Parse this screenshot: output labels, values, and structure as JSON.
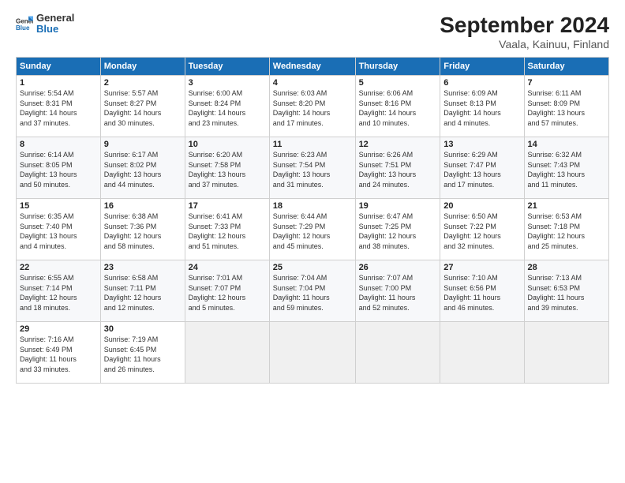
{
  "header": {
    "logo_general": "General",
    "logo_blue": "Blue",
    "title": "September 2024",
    "subtitle": "Vaala, Kainuu, Finland"
  },
  "days_of_week": [
    "Sunday",
    "Monday",
    "Tuesday",
    "Wednesday",
    "Thursday",
    "Friday",
    "Saturday"
  ],
  "weeks": [
    [
      {
        "day": "1",
        "info": "Sunrise: 5:54 AM\nSunset: 8:31 PM\nDaylight: 14 hours\nand 37 minutes."
      },
      {
        "day": "2",
        "info": "Sunrise: 5:57 AM\nSunset: 8:27 PM\nDaylight: 14 hours\nand 30 minutes."
      },
      {
        "day": "3",
        "info": "Sunrise: 6:00 AM\nSunset: 8:24 PM\nDaylight: 14 hours\nand 23 minutes."
      },
      {
        "day": "4",
        "info": "Sunrise: 6:03 AM\nSunset: 8:20 PM\nDaylight: 14 hours\nand 17 minutes."
      },
      {
        "day": "5",
        "info": "Sunrise: 6:06 AM\nSunset: 8:16 PM\nDaylight: 14 hours\nand 10 minutes."
      },
      {
        "day": "6",
        "info": "Sunrise: 6:09 AM\nSunset: 8:13 PM\nDaylight: 14 hours\nand 4 minutes."
      },
      {
        "day": "7",
        "info": "Sunrise: 6:11 AM\nSunset: 8:09 PM\nDaylight: 13 hours\nand 57 minutes."
      }
    ],
    [
      {
        "day": "8",
        "info": "Sunrise: 6:14 AM\nSunset: 8:05 PM\nDaylight: 13 hours\nand 50 minutes."
      },
      {
        "day": "9",
        "info": "Sunrise: 6:17 AM\nSunset: 8:02 PM\nDaylight: 13 hours\nand 44 minutes."
      },
      {
        "day": "10",
        "info": "Sunrise: 6:20 AM\nSunset: 7:58 PM\nDaylight: 13 hours\nand 37 minutes."
      },
      {
        "day": "11",
        "info": "Sunrise: 6:23 AM\nSunset: 7:54 PM\nDaylight: 13 hours\nand 31 minutes."
      },
      {
        "day": "12",
        "info": "Sunrise: 6:26 AM\nSunset: 7:51 PM\nDaylight: 13 hours\nand 24 minutes."
      },
      {
        "day": "13",
        "info": "Sunrise: 6:29 AM\nSunset: 7:47 PM\nDaylight: 13 hours\nand 17 minutes."
      },
      {
        "day": "14",
        "info": "Sunrise: 6:32 AM\nSunset: 7:43 PM\nDaylight: 13 hours\nand 11 minutes."
      }
    ],
    [
      {
        "day": "15",
        "info": "Sunrise: 6:35 AM\nSunset: 7:40 PM\nDaylight: 13 hours\nand 4 minutes."
      },
      {
        "day": "16",
        "info": "Sunrise: 6:38 AM\nSunset: 7:36 PM\nDaylight: 12 hours\nand 58 minutes."
      },
      {
        "day": "17",
        "info": "Sunrise: 6:41 AM\nSunset: 7:33 PM\nDaylight: 12 hours\nand 51 minutes."
      },
      {
        "day": "18",
        "info": "Sunrise: 6:44 AM\nSunset: 7:29 PM\nDaylight: 12 hours\nand 45 minutes."
      },
      {
        "day": "19",
        "info": "Sunrise: 6:47 AM\nSunset: 7:25 PM\nDaylight: 12 hours\nand 38 minutes."
      },
      {
        "day": "20",
        "info": "Sunrise: 6:50 AM\nSunset: 7:22 PM\nDaylight: 12 hours\nand 32 minutes."
      },
      {
        "day": "21",
        "info": "Sunrise: 6:53 AM\nSunset: 7:18 PM\nDaylight: 12 hours\nand 25 minutes."
      }
    ],
    [
      {
        "day": "22",
        "info": "Sunrise: 6:55 AM\nSunset: 7:14 PM\nDaylight: 12 hours\nand 18 minutes."
      },
      {
        "day": "23",
        "info": "Sunrise: 6:58 AM\nSunset: 7:11 PM\nDaylight: 12 hours\nand 12 minutes."
      },
      {
        "day": "24",
        "info": "Sunrise: 7:01 AM\nSunset: 7:07 PM\nDaylight: 12 hours\nand 5 minutes."
      },
      {
        "day": "25",
        "info": "Sunrise: 7:04 AM\nSunset: 7:04 PM\nDaylight: 11 hours\nand 59 minutes."
      },
      {
        "day": "26",
        "info": "Sunrise: 7:07 AM\nSunset: 7:00 PM\nDaylight: 11 hours\nand 52 minutes."
      },
      {
        "day": "27",
        "info": "Sunrise: 7:10 AM\nSunset: 6:56 PM\nDaylight: 11 hours\nand 46 minutes."
      },
      {
        "day": "28",
        "info": "Sunrise: 7:13 AM\nSunset: 6:53 PM\nDaylight: 11 hours\nand 39 minutes."
      }
    ],
    [
      {
        "day": "29",
        "info": "Sunrise: 7:16 AM\nSunset: 6:49 PM\nDaylight: 11 hours\nand 33 minutes."
      },
      {
        "day": "30",
        "info": "Sunrise: 7:19 AM\nSunset: 6:45 PM\nDaylight: 11 hours\nand 26 minutes."
      },
      {
        "day": "",
        "info": ""
      },
      {
        "day": "",
        "info": ""
      },
      {
        "day": "",
        "info": ""
      },
      {
        "day": "",
        "info": ""
      },
      {
        "day": "",
        "info": ""
      }
    ]
  ]
}
